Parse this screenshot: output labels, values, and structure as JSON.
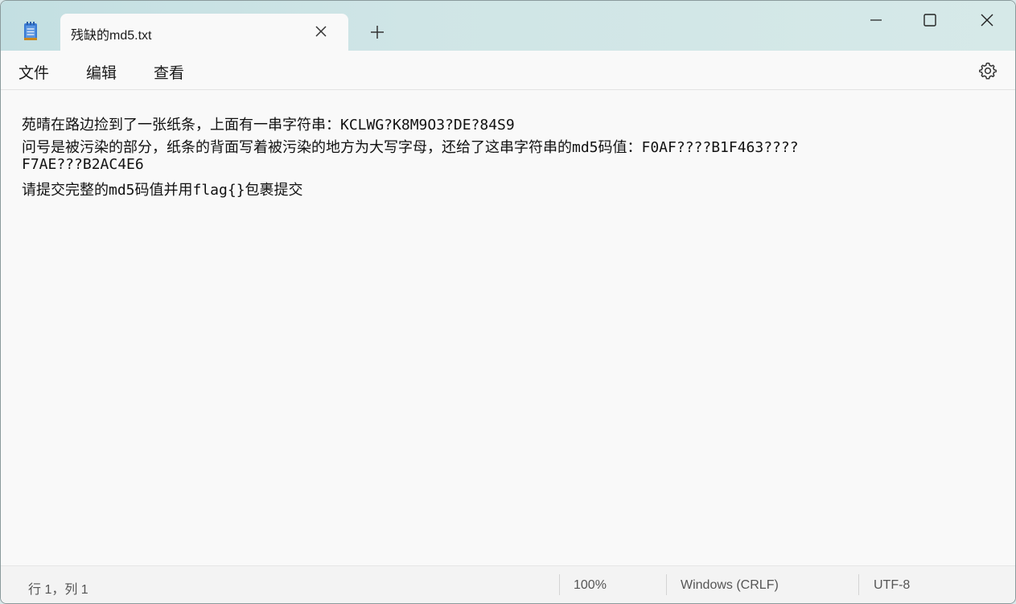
{
  "window": {
    "tab_title": "残缺的md5.txt",
    "accent": "#c3dfe2"
  },
  "icons": {
    "app": "notepad-icon",
    "tab_close": "close-icon",
    "new_tab": "plus-icon",
    "minimize": "minimize-icon",
    "maximize": "maximize-icon",
    "close": "close-icon",
    "settings": "gear-icon"
  },
  "menu": {
    "file": "文件",
    "edit": "编辑",
    "view": "查看"
  },
  "document": {
    "lines": [
      "苑晴在路边捡到了一张纸条，上面有一串字符串：KCLWG?K8M9O3?DE?84S9",
      "问号是被污染的部分，纸条的背面写着被污染的地方为大写字母，还给了这串字符串的md5码值：F0AF????B1F463????",
      "F7AE???B2AC4E6",
      "请提交完整的md5码值并用flag{}包裹提交"
    ]
  },
  "status": {
    "position": "行 1，列 1",
    "zoom": "100%",
    "line_ending": "Windows (CRLF)",
    "encoding": "UTF-8"
  }
}
